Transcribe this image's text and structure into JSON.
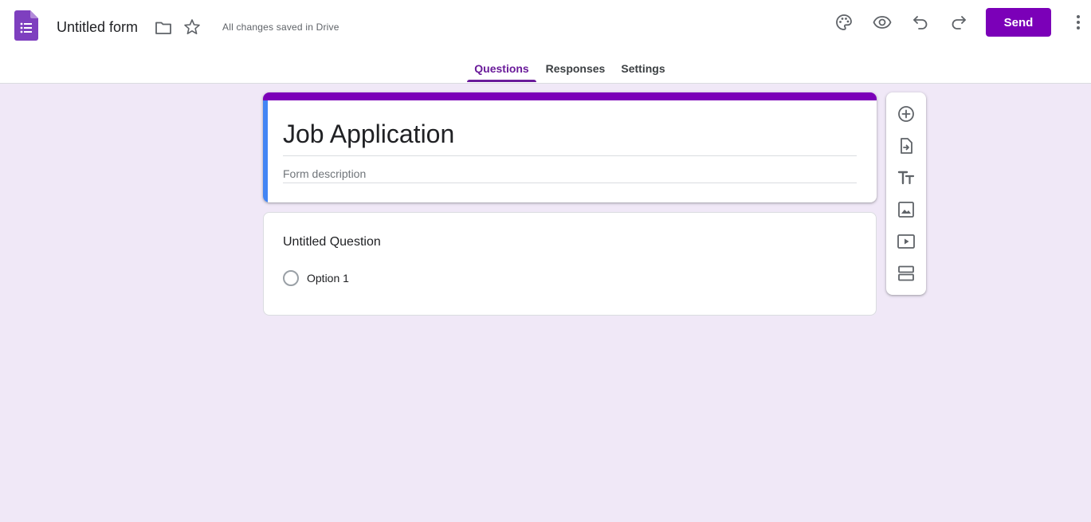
{
  "header": {
    "doc_title": "Untitled form",
    "save_status": "All changes saved in Drive",
    "send_label": "Send",
    "icons": [
      "forms-app-icon",
      "folder-icon",
      "star-icon",
      "palette-icon",
      "preview-icon",
      "undo-icon",
      "redo-icon",
      "more-vert-icon"
    ]
  },
  "tabs": [
    {
      "label": "Questions",
      "active": true
    },
    {
      "label": "Responses",
      "active": false
    },
    {
      "label": "Settings",
      "active": false
    }
  ],
  "form": {
    "title": "Job Application",
    "description_placeholder": "Form description"
  },
  "question": {
    "title": "Untitled Question",
    "options": [
      "Option 1"
    ]
  },
  "side_toolbar": {
    "icons": [
      "add-question-icon",
      "import-questions-icon",
      "add-title-icon",
      "add-image-icon",
      "add-video-icon",
      "add-section-icon"
    ]
  },
  "colors": {
    "accent": "#7b00b8",
    "tab_active": "#6a1b9a",
    "background": "#f0e8f7",
    "card_left_bar": "#4285f4"
  }
}
